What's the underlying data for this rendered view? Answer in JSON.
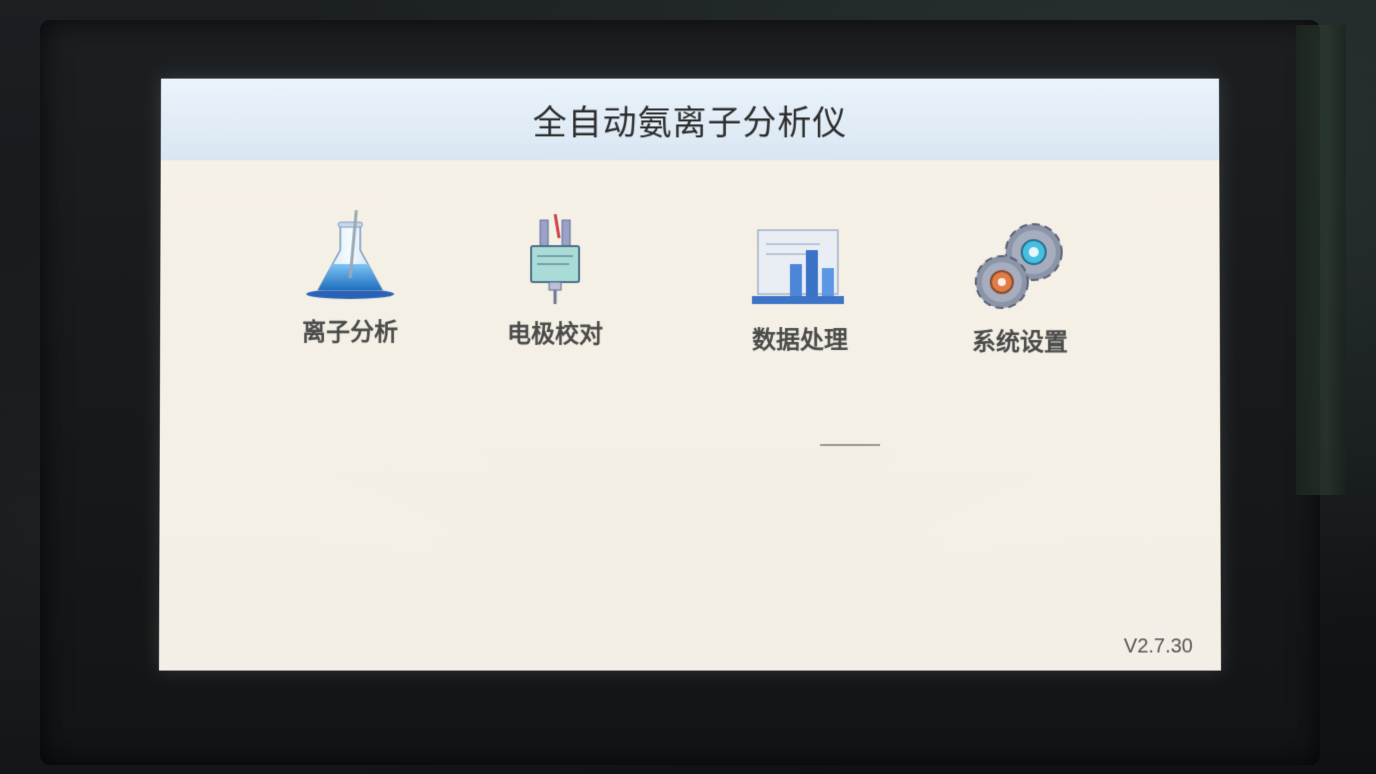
{
  "app": {
    "title": "全自动氨离子分析仪",
    "version": "V2.7.30"
  },
  "menu": {
    "items": [
      {
        "id": "ion-analysis",
        "label": "离子分析",
        "icon": "flask-icon"
      },
      {
        "id": "electrode-calibration",
        "label": "电极校对",
        "icon": "electrode-icon"
      },
      {
        "id": "data-processing",
        "label": "数据处理",
        "icon": "chart-icon"
      },
      {
        "id": "system-settings",
        "label": "系统设置",
        "icon": "gears-icon"
      }
    ]
  },
  "colors": {
    "header_bg": "#dbe7f2",
    "screen_bg": "#f5f0e6",
    "text": "#4a4a4a",
    "accent_blue": "#3d8fd6",
    "gear_gray": "#8a93a6"
  }
}
